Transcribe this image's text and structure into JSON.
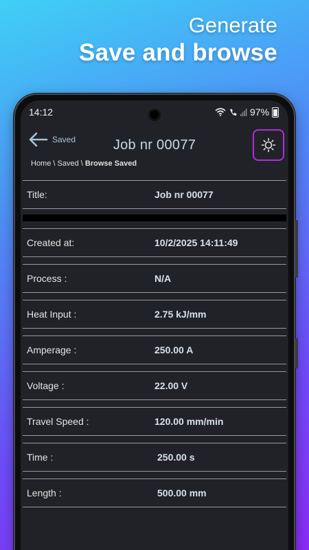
{
  "promo": {
    "line1": "Generate",
    "line2": "Save and browse"
  },
  "status_bar": {
    "time": "14:12",
    "battery": "97%"
  },
  "app_bar": {
    "back_label": "Saved",
    "title": "Job nr 00077",
    "theme_icon": "sun-icon"
  },
  "breadcrumb": {
    "path": "Home \\ Saved \\ ",
    "current": "Browse Saved"
  },
  "fields": [
    {
      "label": "Title:",
      "value": "Job nr 00077"
    },
    {
      "label": "Created at:",
      "value": "10/2/2025 14:11:49"
    },
    {
      "label": "Process :",
      "value": "N/A"
    },
    {
      "label": "Heat Input :",
      "value": "2.75 kJ/mm"
    },
    {
      "label": "Amperage :",
      "value": "250.00 A"
    },
    {
      "label": "Voltage :",
      "value": "22.00 V"
    },
    {
      "label": "Travel Speed :",
      "value": "120.00  mm/min"
    },
    {
      "label": "Time :",
      "value": "250.00  s"
    },
    {
      "label": "Length :",
      "value": "500.00  mm"
    }
  ],
  "colors": {
    "accent_border": "#b22be0",
    "screen_bg": "#212227"
  }
}
